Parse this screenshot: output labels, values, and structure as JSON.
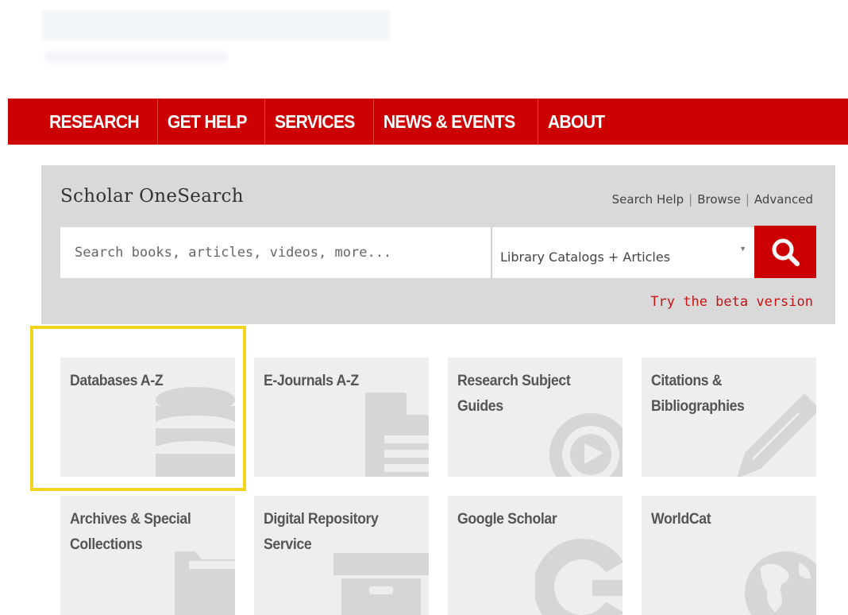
{
  "nav": {
    "items": [
      {
        "label": "RESEARCH"
      },
      {
        "label": "GET HELP"
      },
      {
        "label": "SERVICES"
      },
      {
        "label": "NEWS & EVENTS"
      },
      {
        "label": "ABOUT"
      }
    ]
  },
  "search": {
    "title": "Scholar OneSearch",
    "links": {
      "help": "Search Help",
      "browse": "Browse",
      "advanced": "Advanced"
    },
    "placeholder": "Search books, articles, videos, more...",
    "scope_selected": "Library Catalogs + Articles",
    "beta_link": "Try the beta version"
  },
  "tiles": [
    {
      "label": "Databases A-Z",
      "icon": "database-icon"
    },
    {
      "label": "E-Journals A-Z",
      "icon": "document-icon"
    },
    {
      "label": "Research Subject Guides",
      "icon": "compass-icon"
    },
    {
      "label": "Citations & Bibliographies",
      "icon": "pencil-icon"
    },
    {
      "label": "Archives & Special Collections",
      "icon": "folder-icon"
    },
    {
      "label": "Digital Repository Service",
      "icon": "archive-box-icon"
    },
    {
      "label": "Google Scholar",
      "icon": "google-g-icon"
    },
    {
      "label": "WorldCat",
      "icon": "globe-icon"
    }
  ],
  "colors": {
    "brand_red": "#cc0000",
    "panel_gray": "#d9d9d9",
    "tile_gray": "#eeeeee",
    "highlight_yellow": "#f2d31e"
  }
}
